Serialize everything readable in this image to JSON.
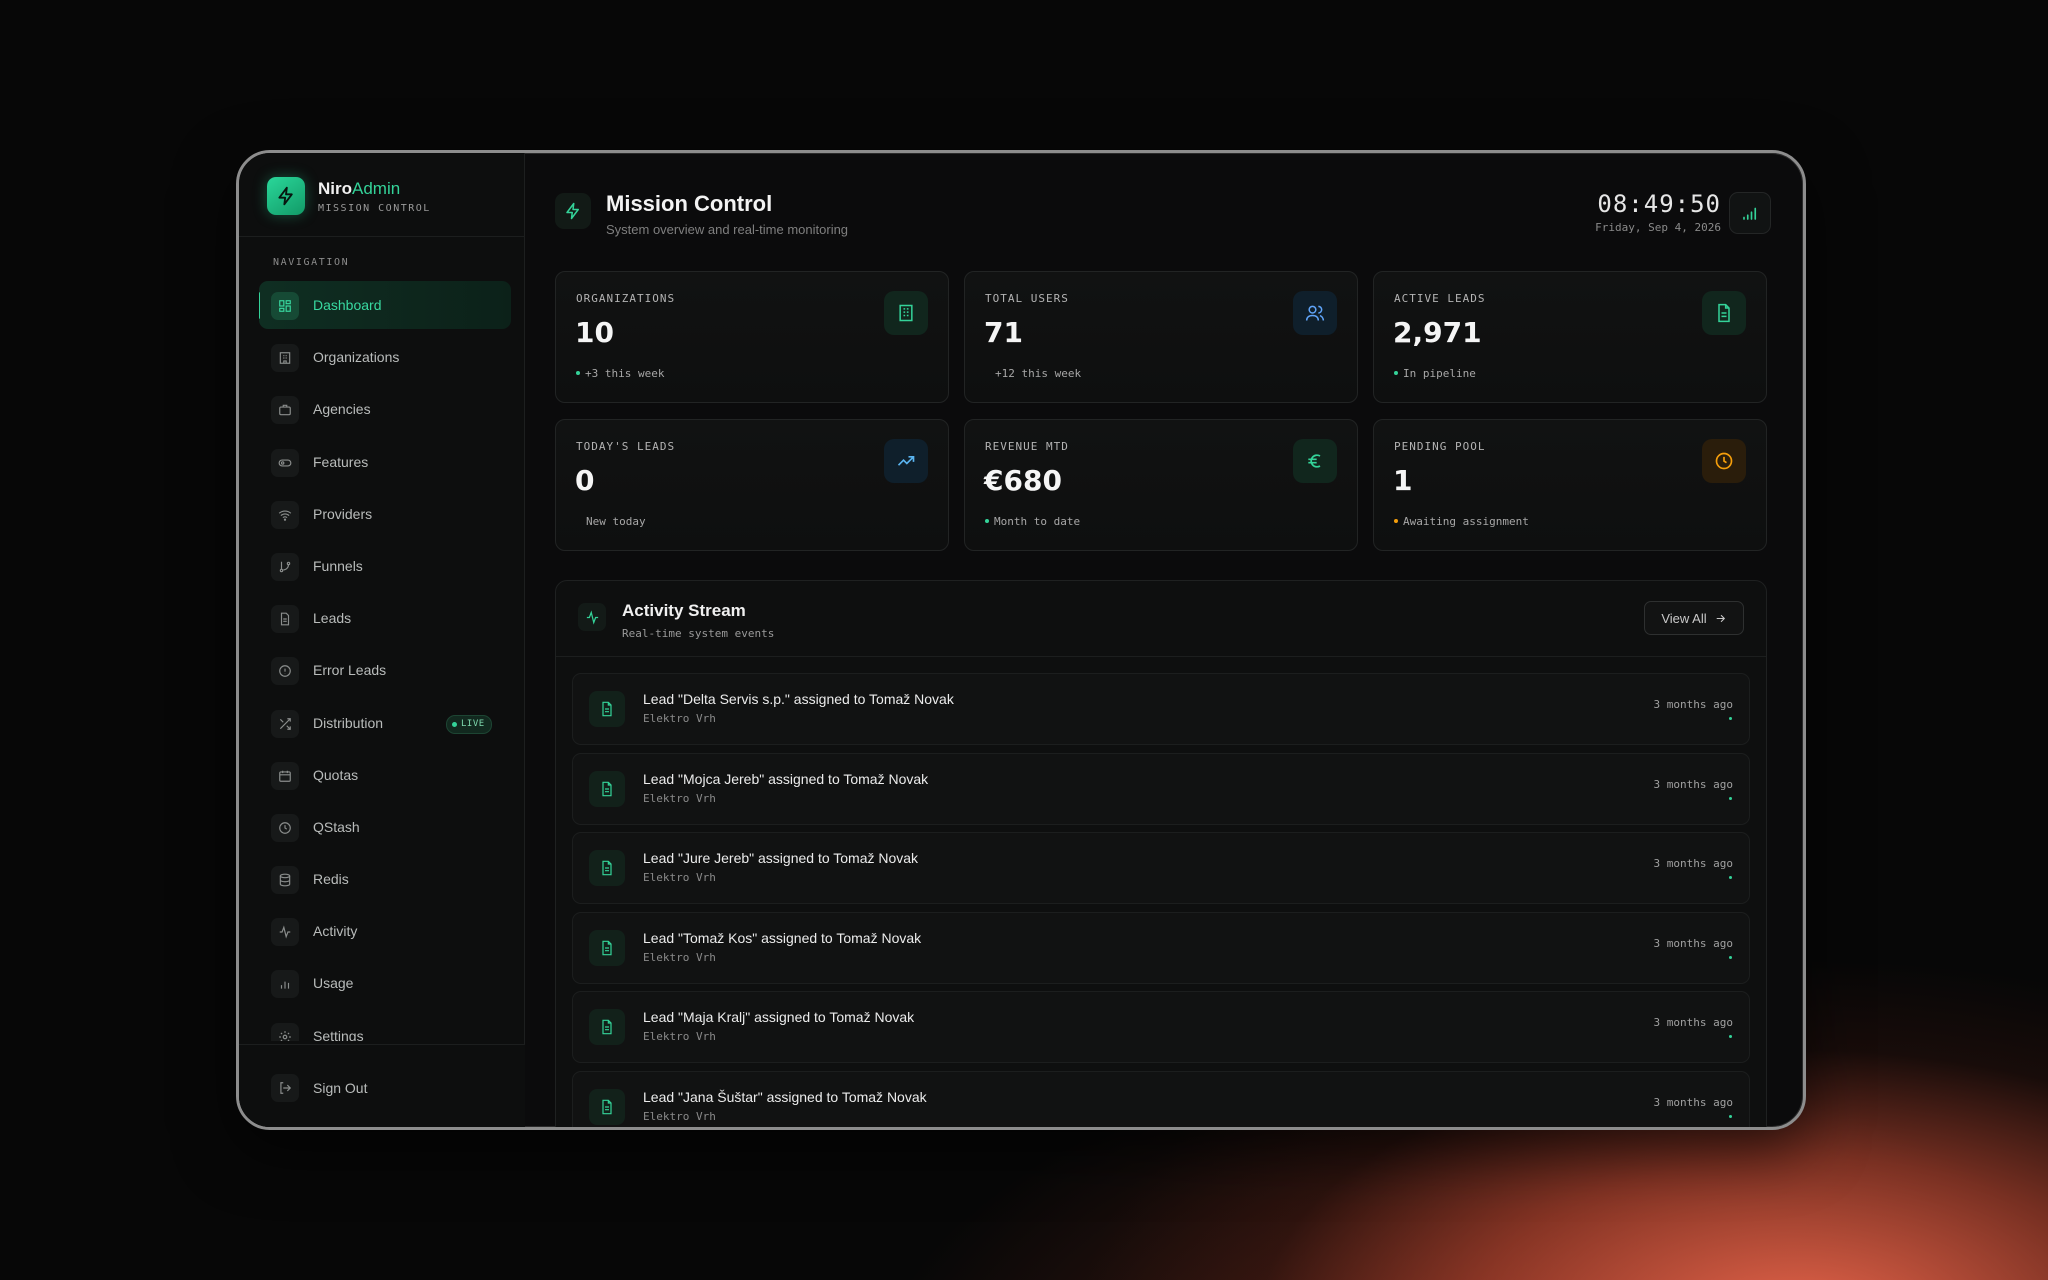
{
  "brand": {
    "name_primary": "Niro",
    "name_accent": "Admin",
    "subtitle": "MISSION CONTROL"
  },
  "sidebar": {
    "section_title": "NAVIGATION",
    "items": [
      {
        "label": "Dashboard",
        "icon": "dashboard-icon",
        "active": true
      },
      {
        "label": "Organizations",
        "icon": "building-icon"
      },
      {
        "label": "Agencies",
        "icon": "briefcase-icon"
      },
      {
        "label": "Features",
        "icon": "toggle-icon"
      },
      {
        "label": "Providers",
        "icon": "wifi-icon"
      },
      {
        "label": "Funnels",
        "icon": "git-branch-icon"
      },
      {
        "label": "Leads",
        "icon": "document-icon"
      },
      {
        "label": "Error Leads",
        "icon": "alert-circle-icon"
      },
      {
        "label": "Distribution",
        "icon": "shuffle-icon",
        "badge": "LIVE"
      },
      {
        "label": "Quotas",
        "icon": "calendar-icon"
      },
      {
        "label": "QStash",
        "icon": "clock-icon"
      },
      {
        "label": "Redis",
        "icon": "database-icon"
      },
      {
        "label": "Activity",
        "icon": "activity-icon"
      },
      {
        "label": "Usage",
        "icon": "bar-chart-icon"
      },
      {
        "label": "Settings",
        "icon": "gear-icon"
      }
    ],
    "signout": {
      "label": "Sign Out",
      "icon": "logout-icon"
    }
  },
  "header": {
    "title": "Mission Control",
    "subtitle": "System overview and real-time monitoring",
    "time": "08:49:50",
    "date": "Friday, Sep 4, 2026"
  },
  "stats": [
    {
      "label": "ORGANIZATIONS",
      "value": "10",
      "note": "+3 this week",
      "icon": "building-icon",
      "color": "#34d399",
      "dot": true
    },
    {
      "label": "TOTAL USERS",
      "value": "71",
      "note": "+12 this week",
      "icon": "users-icon",
      "color": "#60a5fa",
      "dot": false
    },
    {
      "label": "ACTIVE LEADS",
      "value": "2,971",
      "note": "In pipeline",
      "icon": "document-icon",
      "color": "#34d399",
      "dot": true
    },
    {
      "label": "TODAY'S LEADS",
      "value": "0",
      "note": "New today",
      "icon": "trending-up-icon",
      "color": "#5ab4f0",
      "dot": false
    },
    {
      "label": "REVENUE MTD",
      "value": "€680",
      "note": "Month to date",
      "icon": "euro-icon",
      "color": "#34d399",
      "dot": true
    },
    {
      "label": "PENDING POOL",
      "value": "1",
      "note": "Awaiting assignment",
      "icon": "clock-icon",
      "color": "#f59e0b",
      "dot": true
    }
  ],
  "activity": {
    "title": "Activity Stream",
    "subtitle": "Real-time system events",
    "view_all": "View All",
    "events": [
      {
        "title": "Lead \"Delta Servis s.p.\" assigned to Tomaž Novak",
        "org": "Elektro Vrh",
        "time": "3 months ago"
      },
      {
        "title": "Lead \"Mojca Jereb\" assigned to Tomaž Novak",
        "org": "Elektro Vrh",
        "time": "3 months ago"
      },
      {
        "title": "Lead \"Jure Jereb\" assigned to Tomaž Novak",
        "org": "Elektro Vrh",
        "time": "3 months ago"
      },
      {
        "title": "Lead \"Tomaž Kos\" assigned to Tomaž Novak",
        "org": "Elektro Vrh",
        "time": "3 months ago"
      },
      {
        "title": "Lead \"Maja Kralj\" assigned to Tomaž Novak",
        "org": "Elektro Vrh",
        "time": "3 months ago"
      },
      {
        "title": "Lead \"Jana Šuštar\" assigned to Tomaž Novak",
        "org": "Elektro Vrh",
        "time": "3 months ago"
      }
    ]
  },
  "colors": {
    "accent": "#34d399",
    "background": "#0b0b0c",
    "glow": "#f0694e"
  }
}
